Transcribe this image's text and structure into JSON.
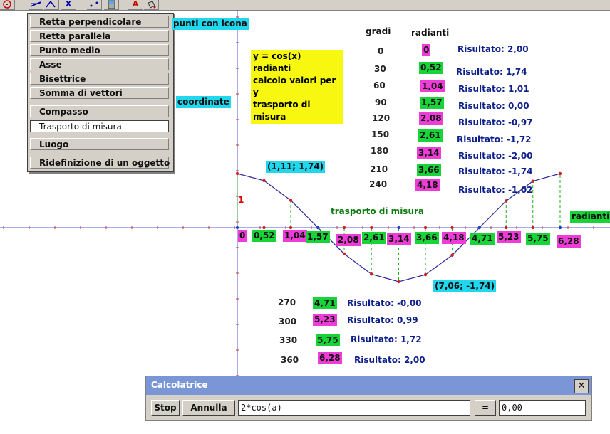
{
  "toolbar": {
    "icons": [
      "circle-icon",
      "line-tools-icon",
      "curve-tools-icon",
      "axis-tools-icon",
      "points-icon",
      "calculator-icon",
      "text-icon",
      "paint-bucket-icon"
    ],
    "letter_a": "A",
    "axis_x_label": "X"
  },
  "menu": {
    "items": [
      {
        "label": "Retta perpendicolare"
      },
      {
        "label": "Retta parallela"
      },
      {
        "label": "Punto medio"
      },
      {
        "label": "Asse"
      },
      {
        "label": "Bisettrice"
      },
      {
        "label": "Somma di vettori"
      },
      {
        "label": "Compasso"
      },
      {
        "label": "Trasporto di misura",
        "selected": true
      },
      {
        "label": "Luogo"
      },
      {
        "label": "Ridefinizione di un oggetto"
      }
    ]
  },
  "labels": {
    "punti_con_icona": "punti con icona",
    "coordinate": "coordinate",
    "gradi": "gradi",
    "radianti_header": "radianti",
    "note_line1": "y = cos(x) radianti",
    "note_line2": "calcolo valori per y",
    "note_line3": "trasporto di misura",
    "trasporto": "trasporto di misura",
    "radianti_axis": "radianti",
    "point_a": "(1,11; 1,74)",
    "point_b": "(7,06; -1,74)",
    "y_one": "1"
  },
  "table_top": [
    {
      "deg": "0",
      "rad": "0",
      "color": "mag",
      "res": "Risultato: 2,00"
    },
    {
      "deg": "30",
      "rad": "0,52",
      "color": "green",
      "res": "Risultato: 1,74"
    },
    {
      "deg": "60",
      "rad": "1,04",
      "color": "mag",
      "res": "Risultato: 1,01"
    },
    {
      "deg": "90",
      "rad": "1,57",
      "color": "green",
      "res": "Risultato: 0,00"
    },
    {
      "deg": "120",
      "rad": "2,08",
      "color": "mag",
      "res": "Risultato: -0,97"
    },
    {
      "deg": "150",
      "rad": "2,61",
      "color": "green",
      "res": "Risultato: -1,72"
    },
    {
      "deg": "180",
      "rad": "3,14",
      "color": "mag",
      "res": "Risultato: -2,00"
    },
    {
      "deg": "210",
      "rad": "3,66",
      "color": "green",
      "res": "Risultato: -1,74"
    },
    {
      "deg": "240",
      "rad": "4,18",
      "color": "mag",
      "res": "Risultato: -1,02"
    }
  ],
  "table_bottom": [
    {
      "deg": "270",
      "rad": "4,71",
      "color": "green",
      "res": "Risultato: -0,00"
    },
    {
      "deg": "300",
      "rad": "5,23",
      "color": "mag",
      "res": "Risultato: 0,99"
    },
    {
      "deg": "330",
      "rad": "5,75",
      "color": "green",
      "res": "Risultato: 1,72"
    },
    {
      "deg": "360",
      "rad": "6,28",
      "color": "mag",
      "res": "Risultato: 2,00"
    }
  ],
  "axis_ticks": [
    {
      "label": "0",
      "color": "mag"
    },
    {
      "label": "0,52",
      "color": "green"
    },
    {
      "label": "1,04",
      "color": "mag"
    },
    {
      "label": "1,57",
      "color": "green"
    },
    {
      "label": "2,08",
      "color": "mag"
    },
    {
      "label": "2,61",
      "color": "green"
    },
    {
      "label": "3,14",
      "color": "mag"
    },
    {
      "label": "3,66",
      "color": "green"
    },
    {
      "label": "4,18",
      "color": "mag"
    },
    {
      "label": "4,71",
      "color": "green"
    },
    {
      "label": "5,23",
      "color": "mag"
    },
    {
      "label": "5,75",
      "color": "green"
    },
    {
      "label": "6,28",
      "color": "mag"
    }
  ],
  "curve": {
    "x": [
      0,
      0.52,
      1.04,
      1.57,
      2.08,
      2.61,
      3.14,
      3.66,
      4.18,
      4.71,
      5.23,
      5.75,
      6.28
    ],
    "y": [
      2.0,
      1.74,
      1.01,
      0.0,
      -0.97,
      -1.72,
      -2.0,
      -1.74,
      -1.02,
      -0.0,
      0.99,
      1.72,
      2.0
    ]
  },
  "calculator": {
    "title": "Calcolatrice",
    "close": "✕",
    "stop": "Stop",
    "annulla": "Annulla",
    "expression": "2*cos(a)",
    "equals": "=",
    "result": "0,00"
  },
  "colors": {
    "cyan": "#21d7ee",
    "green": "#18d438",
    "magenta": "#ee3cd6",
    "yellow": "#f7f70f",
    "result_blue": "#0c1f8a"
  }
}
